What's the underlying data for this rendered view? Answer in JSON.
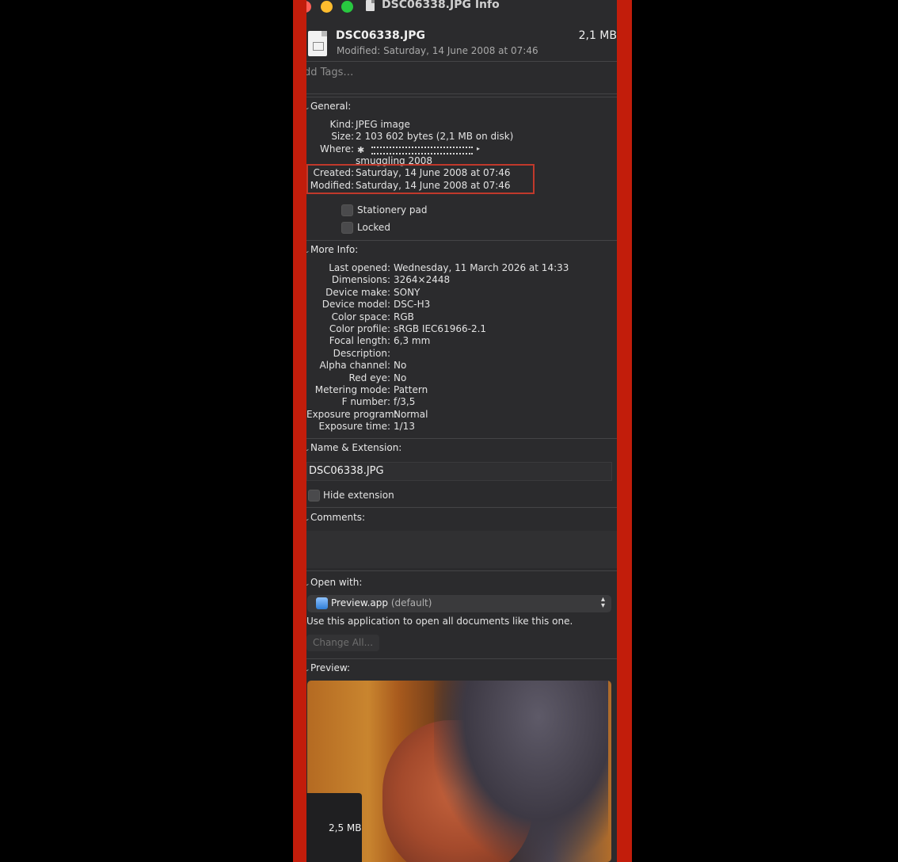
{
  "window": {
    "title": "DSC06338.JPG Info",
    "traffic_light_colors": [
      "#ff5f57",
      "#febc2e",
      "#28c840"
    ]
  },
  "header": {
    "file_name": "DSC06338.JPG",
    "file_size": "2,1 MB",
    "modified": "Modified: Saturday, 14 June 2008 at 07:46"
  },
  "tags": {
    "placeholder": "dd Tags…"
  },
  "general": {
    "header": "General:",
    "kind_label": "Kind:",
    "kind_value": "JPEG image",
    "size_label": "Size:",
    "size_value": "2 103 602 bytes (2,1 MB on disk)",
    "where_label": "Where:",
    "where_value_2": "smuggling 2008",
    "created_label": "Created:",
    "created_value": "Saturday, 14 June 2008 at 07:46",
    "modified_label": "Modified:",
    "modified_value": "Saturday, 14 June 2008 at 07:46",
    "stationery_label": "Stationery pad",
    "locked_label": "Locked"
  },
  "more_info": {
    "header": "More Info:",
    "rows": [
      {
        "label": "Last opened:",
        "value": "Wednesday, 11 March 2026 at 14:33"
      },
      {
        "label": "Dimensions:",
        "value": "3264×2448"
      },
      {
        "label": "Device make:",
        "value": "SONY"
      },
      {
        "label": "Device model:",
        "value": "DSC-H3"
      },
      {
        "label": "Color space:",
        "value": "RGB"
      },
      {
        "label": "Color profile:",
        "value": "sRGB IEC61966-2.1"
      },
      {
        "label": "Focal length:",
        "value": "6,3 mm"
      },
      {
        "label": "Description:",
        "value": ""
      },
      {
        "label": "Alpha channel:",
        "value": "No"
      },
      {
        "label": "Red eye:",
        "value": "No"
      },
      {
        "label": "Metering mode:",
        "value": "Pattern"
      },
      {
        "label": "F number:",
        "value": "f/3,5"
      },
      {
        "label": "Exposure program:",
        "value": "Normal"
      },
      {
        "label": "Exposure time:",
        "value": "1/13"
      }
    ]
  },
  "name_extension": {
    "header": "Name & Extension:",
    "value": "DSC06338.JPG",
    "hide_extension_label": "Hide extension"
  },
  "comments": {
    "header": "Comments:"
  },
  "open_with": {
    "header": "Open with:",
    "app_name": "Preview.app",
    "app_default": "(default)",
    "description": "Use this application to open all documents like this one.",
    "change_all_label": "Change All..."
  },
  "preview": {
    "header": "Preview:",
    "size_overlay": "2,5 MB"
  },
  "colors": {
    "frame": "#c21d0b",
    "panel_bg": "#2b2b2d",
    "highlight_box": "#c0392b"
  }
}
